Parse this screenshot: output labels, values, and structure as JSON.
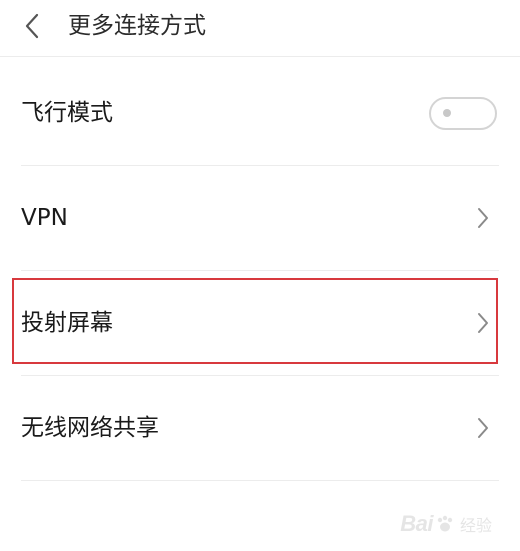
{
  "header": {
    "back_icon": "chevron-left-icon",
    "title": "更多连接方式"
  },
  "rows": [
    {
      "label": "飞行模式",
      "control": "toggle",
      "toggle_on": false
    },
    {
      "label": "VPN",
      "control": "chevron-right-icon"
    },
    {
      "label": "投射屏幕",
      "control": "chevron-right-icon",
      "highlighted": true
    },
    {
      "label": "无线网络共享",
      "control": "chevron-right-icon"
    }
  ],
  "watermark": {
    "text": "Bai",
    "suffix": "经验"
  },
  "colors": {
    "highlight_border": "#d8393e",
    "divider": "#ececec",
    "chevron": "#8a8a8a"
  }
}
